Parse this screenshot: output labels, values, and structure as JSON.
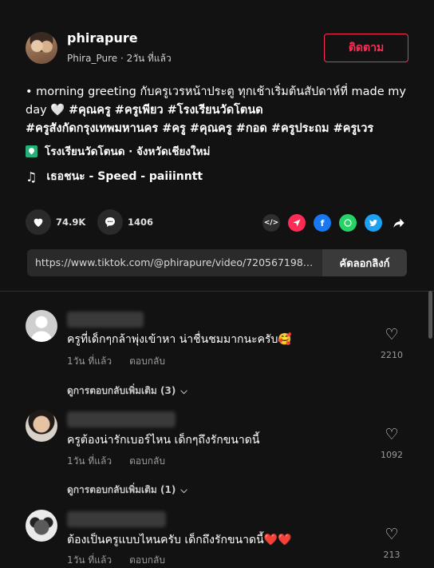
{
  "post": {
    "username": "phirapure",
    "handle": "Phira_Pure",
    "separator": " · ",
    "time_ago": "2วัน ที่แล้ว",
    "follow_label": "ติดตาม",
    "caption_text": "• morning greeting กับครูเวรหน้าประตู ทุกเช้าเริ่มต้นสัปดาห์ที่ made my day 🤍",
    "hashtags_line1": "#คุณครู #ครูเพียว #โรงเรียนวัดโตนด",
    "hashtags_line2": "#ครูสังกัดกรุงเทพมหานคร #ครู #คุณครู #กอด #ครูประถม #ครูเวร",
    "location": "โรงเรียนวัดโตนด · จังหวัดเชียงใหม่",
    "music": "เธอชนะ - Speed - paiiinntt"
  },
  "actions": {
    "like_count": "74.9K",
    "comment_count": "1406"
  },
  "share": {
    "icons": [
      "embed-icon",
      "send-icon",
      "facebook-icon",
      "whatsapp-icon",
      "twitter-icon",
      "share-arrow-icon"
    ],
    "link": "https://www.tiktok.com/@phirapure/video/720567198616...",
    "copy_label": "คัดลอกลิงก์"
  },
  "comments": [
    {
      "text": "ครูที่เด็กๆกล้าพุ่งเข้าหา น่าชื่นชมมากนะครับ🥰",
      "time": "1วัน ที่แล้ว",
      "reply_label": "ตอบกลับ",
      "likes": "2210",
      "more_replies": "ดูการตอบกลับเพิ่มเติม (3)"
    },
    {
      "text": "ครูต้องน่ารักเบอร์ไหน เด็กๆถึงรักขนาดนี้",
      "time": "1วัน ที่แล้ว",
      "reply_label": "ตอบกลับ",
      "likes": "1092",
      "more_replies": "ดูการตอบกลับเพิ่มเติม (1)"
    },
    {
      "text": "ต้องเป็นครูแบบไหนครับ เด็กถึงรักขนาดนี้❤️❤️",
      "time": "1วัน ที่แล้ว",
      "reply_label": "ตอบกลับ",
      "likes": "213"
    }
  ],
  "colors": {
    "background": "#121212",
    "accent": "#fe2c55"
  }
}
